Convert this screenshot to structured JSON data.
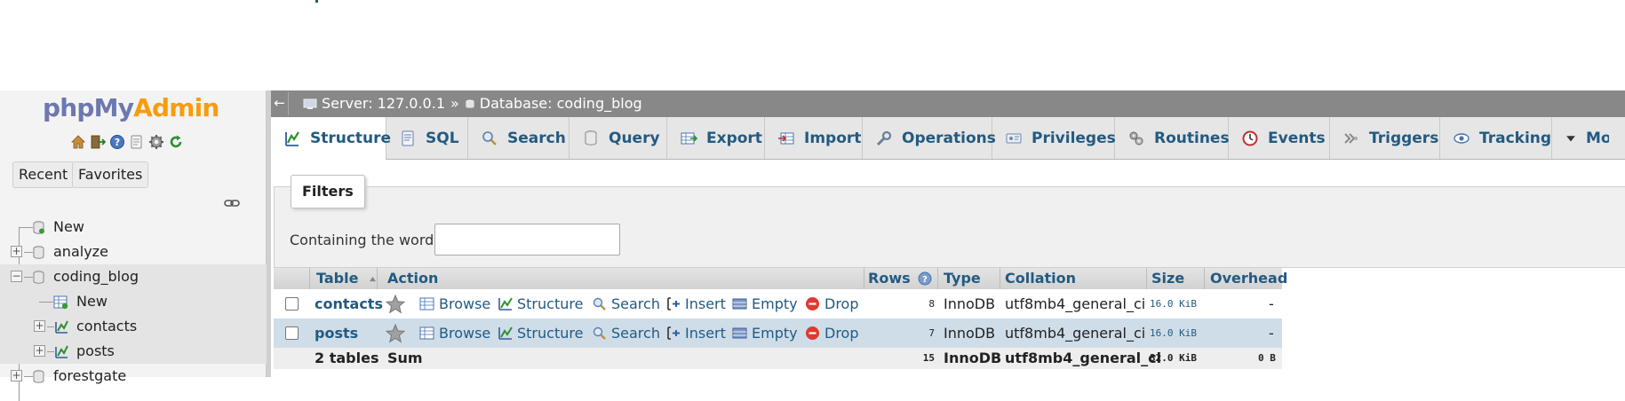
{
  "app": {
    "logo_php": "php",
    "logo_my": "My",
    "logo_admin": "Admin"
  },
  "nav": {
    "quick_icons": [
      "home-icon",
      "logout-icon",
      "help-icon",
      "docs-icon",
      "settings-icon",
      "reload-icon"
    ],
    "recent_label": "Recent",
    "favorites_label": "Favorites",
    "tree": [
      {
        "label": "New",
        "level": 0,
        "kind": "new"
      },
      {
        "label": "analyze",
        "level": 0,
        "kind": "db",
        "expander": "+"
      },
      {
        "label": "coding_blog",
        "level": 0,
        "kind": "db",
        "expander": "−",
        "selected": true
      },
      {
        "label": "New",
        "level": 1,
        "kind": "new"
      },
      {
        "label": "contacts",
        "level": 1,
        "kind": "table",
        "expander": "+"
      },
      {
        "label": "posts",
        "level": 1,
        "kind": "table",
        "expander": "+"
      },
      {
        "label": "forestgate",
        "level": 0,
        "kind": "db",
        "expander": "+"
      }
    ]
  },
  "breadcrumb": {
    "collapse": "←",
    "server_label": "Server: 127.0.0.1",
    "separator": "»",
    "database_label": "Database: coding_blog"
  },
  "tabs": [
    {
      "label": "Structure",
      "icon": "structure-icon",
      "active": true
    },
    {
      "label": "SQL",
      "icon": "sql-icon"
    },
    {
      "label": "Search",
      "icon": "search-icon"
    },
    {
      "label": "Query",
      "icon": "query-icon"
    },
    {
      "label": "Export",
      "icon": "export-icon"
    },
    {
      "label": "Import",
      "icon": "import-icon"
    },
    {
      "label": "Operations",
      "icon": "wrench-icon"
    },
    {
      "label": "Privileges",
      "icon": "privileges-icon"
    },
    {
      "label": "Routines",
      "icon": "routines-icon"
    },
    {
      "label": "Events",
      "icon": "events-icon"
    },
    {
      "label": "Triggers",
      "icon": "triggers-icon"
    },
    {
      "label": "Tracking",
      "icon": "tracking-icon"
    },
    {
      "label": "More",
      "icon": "more-icon"
    }
  ],
  "filters": {
    "legend": "Filters",
    "label": "Containing the word:",
    "value": ""
  },
  "table": {
    "headers": {
      "table": "Table",
      "action": "Action",
      "rows": "Rows",
      "type": "Type",
      "collation": "Collation",
      "size": "Size",
      "overhead": "Overhead"
    },
    "actions": [
      "Browse",
      "Structure",
      "Search",
      "Insert",
      "Empty",
      "Drop"
    ],
    "rows": [
      {
        "name": "contacts",
        "rows": "8",
        "type": "InnoDB",
        "collation": "utf8mb4_general_ci",
        "size": "16.0 KiB",
        "overhead": "-"
      },
      {
        "name": "posts",
        "rows": "7",
        "type": "InnoDB",
        "collation": "utf8mb4_general_ci",
        "size": "16.0 KiB",
        "overhead": "-"
      }
    ],
    "footer": {
      "tables": "2 tables",
      "sum": "Sum",
      "rows": "15",
      "type": "InnoDB",
      "collation": "utf8mb4_general_ci",
      "size": "32.0 KiB",
      "overhead": "0 B"
    }
  }
}
